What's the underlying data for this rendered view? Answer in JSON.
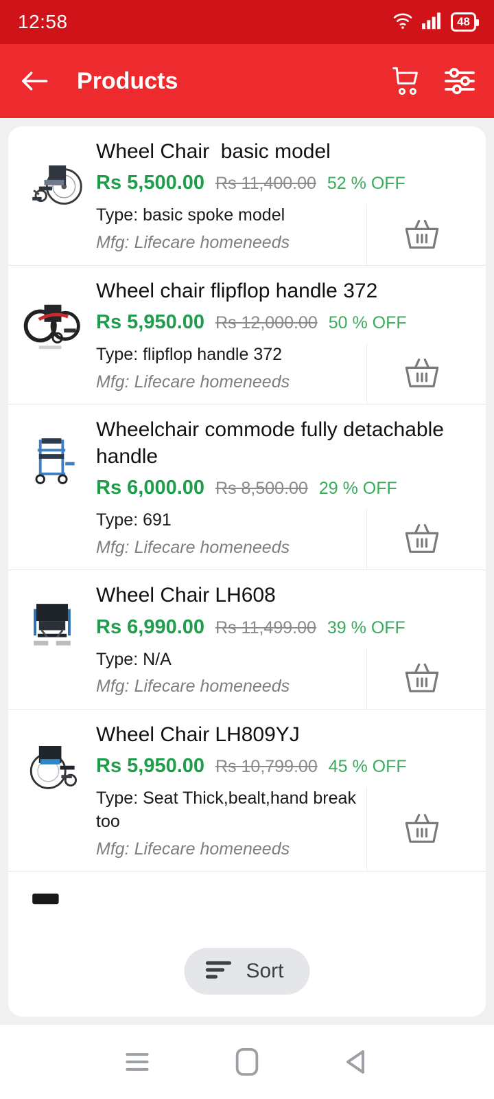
{
  "statusbar": {
    "time": "12:58",
    "battery_level": "48",
    "wifi_icon": "wifi-icon",
    "signal_icon": "signal-bars-icon",
    "battery_icon": "battery-icon"
  },
  "appbar": {
    "title": "Products",
    "back_icon": "back-arrow-icon",
    "cart_icon": "shopping-cart-icon",
    "filter_icon": "filter-sliders-icon"
  },
  "products": [
    {
      "title": "Wheel Chair  basic model",
      "price": "Rs 5,500.00",
      "mrp": "Rs 11,400.00",
      "discount": "52 % OFF",
      "type": "Type: basic spoke model",
      "mfg": "Mfg: Lifecare homeneeds",
      "image": "wheelchair-basic-spoke-thumbnail",
      "basket_icon": "basket-icon"
    },
    {
      "title": "Wheel chair flipflop handle 372",
      "price": "Rs 5,950.00",
      "mrp": "Rs 12,000.00",
      "discount": "50 % OFF",
      "type": "Type: flipflop handle 372",
      "mfg": "Mfg: Lifecare homeneeds",
      "image": "wheelchair-flipflop-red-thumbnail",
      "basket_icon": "basket-icon"
    },
    {
      "title": "Wheelchair commode fully detachable handle",
      "price": "Rs 6,000.00",
      "mrp": "Rs 8,500.00",
      "discount": "29 % OFF",
      "type": "Type: 691",
      "mfg": "Mfg: Lifecare homeneeds",
      "image": "wheelchair-commode-blue-thumbnail",
      "basket_icon": "basket-icon"
    },
    {
      "title": "Wheel Chair LH608",
      "price": "Rs 6,990.00",
      "mrp": "Rs 11,499.00",
      "discount": "39 % OFF",
      "type": "Type: N/A",
      "mfg": "Mfg: Lifecare homeneeds",
      "image": "wheelchair-lh608-thumbnail",
      "basket_icon": "basket-icon"
    },
    {
      "title": "Wheel Chair LH809YJ",
      "price": "Rs 5,950.00",
      "mrp": "Rs 10,799.00",
      "discount": "45 % OFF",
      "type": "Type: Seat Thick,bealt,hand break too",
      "mfg": "Mfg: Lifecare homeneeds",
      "image": "wheelchair-lh809yj-thumbnail",
      "basket_icon": "basket-icon"
    }
  ],
  "sort_button": {
    "label": "Sort",
    "icon": "sort-lines-icon"
  },
  "navbar": {
    "recents_icon": "recents-menu-icon",
    "home_icon": "home-square-icon",
    "back_icon": "back-triangle-icon"
  },
  "colors": {
    "status_red": "#d01318",
    "appbar_red": "#ed2b2e",
    "price_green": "#1f9d4d",
    "discount_green": "#3aab5c",
    "mrp_gray": "#8a8a8a"
  }
}
